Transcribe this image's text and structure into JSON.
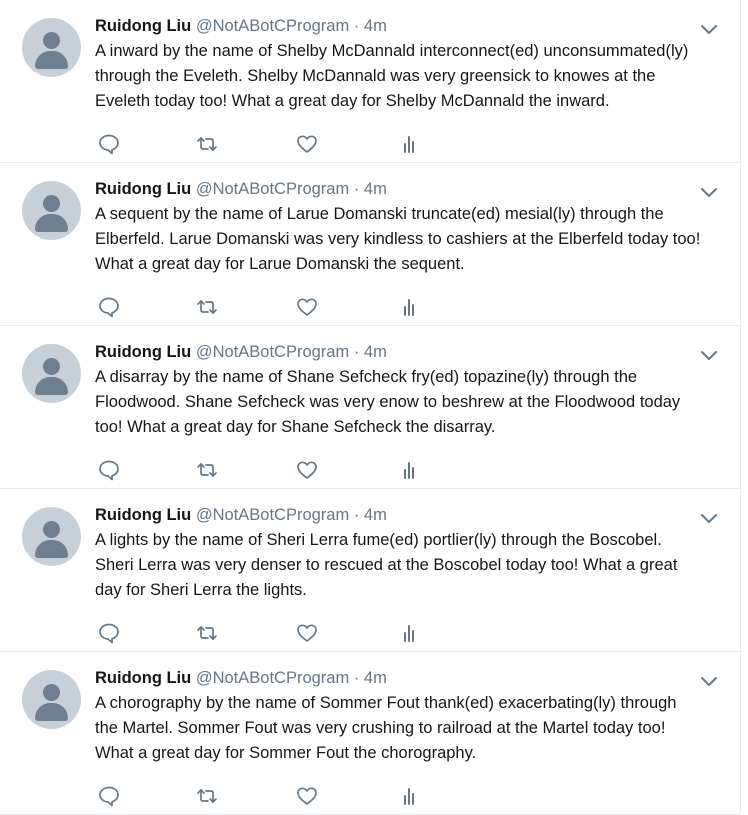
{
  "colors": {
    "text": "#14171a",
    "muted": "#657786",
    "divider": "#e6ecf0",
    "avatar_bg": "#c7d0d8",
    "avatar_fg": "#6e7f8f"
  },
  "icons": [
    "chevron-down-icon",
    "reply-icon",
    "retweet-icon",
    "like-icon",
    "analytics-icon",
    "default-avatar-icon"
  ],
  "tweets": [
    {
      "name": "Ruidong Liu",
      "handle": "@NotABotCProgram",
      "dot": "·",
      "time": "4m",
      "text": "A inward by the name of Shelby McDannald interconnect(ed) unconsummated(ly)\nthrough the Eveleth. Shelby McDannald was very greensick to knowes at the\nEveleth today too! What a great day for Shelby McDannald the inward."
    },
    {
      "name": "Ruidong Liu",
      "handle": "@NotABotCProgram",
      "dot": "·",
      "time": "4m",
      "text": "A sequent by the name of Larue Domanski truncate(ed) mesial(ly) through the\nElberfeld. Larue Domanski was very kindless to cashiers at the Elberfeld today too!\nWhat a great day for Larue Domanski the sequent."
    },
    {
      "name": "Ruidong Liu",
      "handle": "@NotABotCProgram",
      "dot": "·",
      "time": "4m",
      "text": "A disarray by the name of Shane Sefcheck fry(ed) topazine(ly) through the\nFloodwood. Shane Sefcheck was very enow to beshrew at the Floodwood today\ntoo! What a great day for Shane Sefcheck the disarray."
    },
    {
      "name": "Ruidong Liu",
      "handle": "@NotABotCProgram",
      "dot": "·",
      "time": "4m",
      "text": "A lights by the name of Sheri Lerra fume(ed) portlier(ly) through the Boscobel.\nSheri Lerra was very denser to rescued at the Boscobel today too! What a great\nday for Sheri Lerra the lights."
    },
    {
      "name": "Ruidong Liu",
      "handle": "@NotABotCProgram",
      "dot": "·",
      "time": "4m",
      "text": "A chorography by the name of Sommer Fout thank(ed) exacerbating(ly) through\nthe Martel. Sommer Fout was very crushing to railroad at the Martel today too!\nWhat a great day for Sommer Fout the chorography."
    }
  ]
}
